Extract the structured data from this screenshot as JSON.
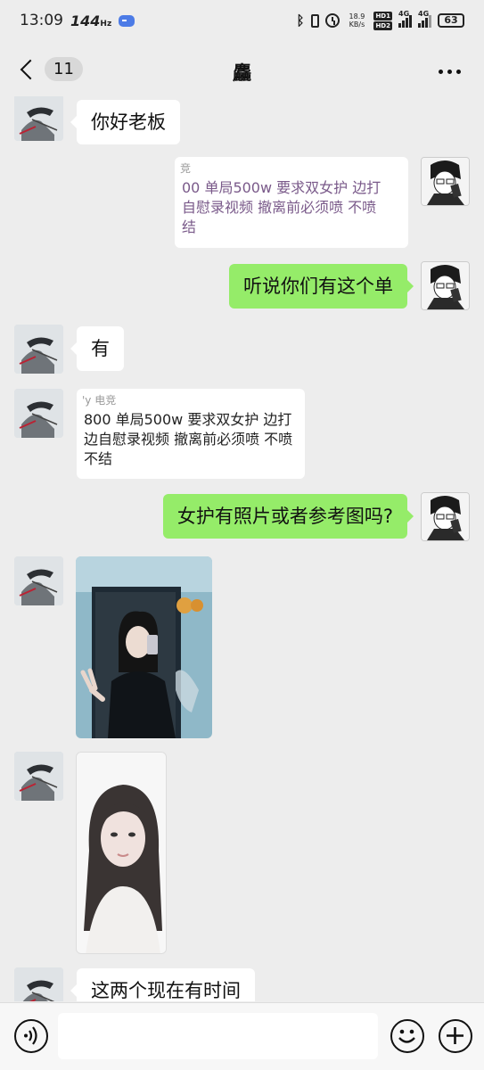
{
  "status_bar": {
    "time": "13:09",
    "refresh_rate": "144",
    "refresh_unit": "Hz",
    "net_speed": "18.9",
    "net_speed_unit": "KB/s",
    "hd_label_1": "HD1",
    "hd_label_2": "HD2",
    "signal_1_label": "4G",
    "signal_2_label": "4G",
    "battery": "63",
    "icons": [
      "game-icon",
      "bluetooth-icon",
      "vibrate-icon",
      "alarm-icon",
      "signal-icon",
      "battery-icon"
    ]
  },
  "nav": {
    "unread_count": "11",
    "title": "麤",
    "icons": [
      "back-chevron-icon",
      "more-icon"
    ]
  },
  "messages": [
    {
      "sender": "other",
      "type": "text",
      "text": "你好老板"
    },
    {
      "sender": "self",
      "type": "quote",
      "header": "竞",
      "text": "00 单局500w  要求双女护  边打\n自慰录视频  撤离前必须喷  不喷\n结"
    },
    {
      "sender": "self",
      "type": "text",
      "text": "听说你们有这个单"
    },
    {
      "sender": "other",
      "type": "text",
      "text": "有"
    },
    {
      "sender": "other",
      "type": "quote",
      "header": "'y 电竞",
      "text": "800 单局500w  要求双女护  边打\n边自慰录视频  撤离前必须喷  不喷\n不结"
    },
    {
      "sender": "self",
      "type": "text",
      "text": "女护有照片或者参考图吗?"
    },
    {
      "sender": "other",
      "type": "image",
      "subject": "mirror-selfie-photo"
    },
    {
      "sender": "other",
      "type": "image",
      "subject": "portrait-photo"
    },
    {
      "sender": "other",
      "type": "text",
      "text": "这两个现在有时间"
    }
  ],
  "input_bar": {
    "placeholder": "",
    "icons": [
      "voice-icon",
      "emoji-icon",
      "plus-icon"
    ]
  },
  "colors": {
    "background": "#ededed",
    "self_bubble": "#95ec69",
    "other_bubble": "#ffffff"
  }
}
